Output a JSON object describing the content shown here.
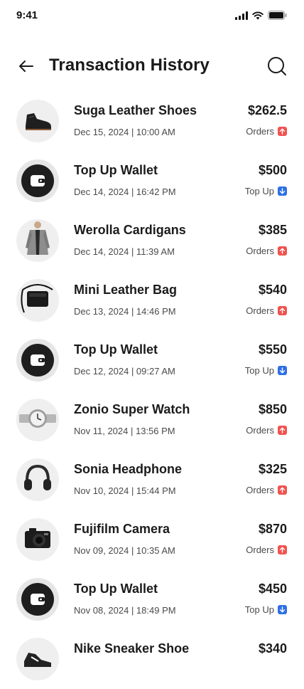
{
  "status_bar": {
    "time": "9:41"
  },
  "header": {
    "title": "Transaction History"
  },
  "colors": {
    "orders_badge": "#ef5350",
    "topup_badge": "#2f6fe4"
  },
  "transactions": [
    {
      "name": "Suga Leather Shoes",
      "date": "Dec 15, 2024 | 10:00 AM",
      "amount": "$262.5",
      "type": "Orders",
      "icon": "shoe-icon"
    },
    {
      "name": "Top Up Wallet",
      "date": "Dec 14, 2024 | 16:42 PM",
      "amount": "$500",
      "type": "Top Up",
      "icon": "wallet-icon"
    },
    {
      "name": "Werolla Cardigans",
      "date": "Dec 14, 2024 | 11:39 AM",
      "amount": "$385",
      "type": "Orders",
      "icon": "cardigan-icon"
    },
    {
      "name": "Mini Leather Bag",
      "date": "Dec 13, 2024 | 14:46 PM",
      "amount": "$540",
      "type": "Orders",
      "icon": "bag-icon"
    },
    {
      "name": "Top Up Wallet",
      "date": "Dec 12, 2024 | 09:27 AM",
      "amount": "$550",
      "type": "Top Up",
      "icon": "wallet-icon"
    },
    {
      "name": "Zonio Super Watch",
      "date": "Nov 11, 2024 | 13:56 PM",
      "amount": "$850",
      "type": "Orders",
      "icon": "watch-icon"
    },
    {
      "name": "Sonia Headphone",
      "date": "Nov 10, 2024 | 15:44 PM",
      "amount": "$325",
      "type": "Orders",
      "icon": "headphone-icon"
    },
    {
      "name": "Fujifilm Camera",
      "date": "Nov 09, 2024 | 10:35 AM",
      "amount": "$870",
      "type": "Orders",
      "icon": "camera-icon"
    },
    {
      "name": "Top Up Wallet",
      "date": "Nov 08, 2024 | 18:49 PM",
      "amount": "$450",
      "type": "Top Up",
      "icon": "wallet-icon"
    },
    {
      "name": "Nike Sneaker Shoe",
      "date": "",
      "amount": "$340",
      "type": "",
      "icon": "sneaker-icon"
    }
  ]
}
